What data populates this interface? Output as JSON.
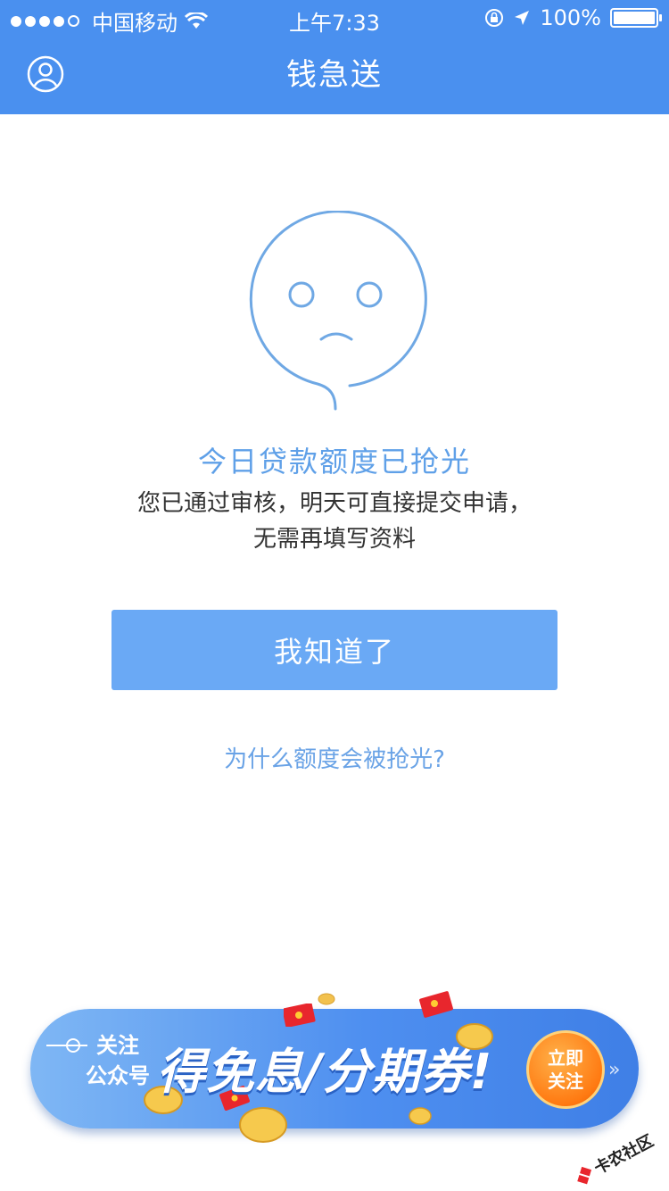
{
  "status_bar": {
    "carrier": "中国移动",
    "time": "上午7:33",
    "battery_percent": "100%",
    "battery_level": 1.0
  },
  "nav": {
    "title": "钱急送"
  },
  "main": {
    "title": "今日贷款额度已抢光",
    "desc_line1": "您已通过审核，明天可直接提交申请，",
    "desc_line2": "无需再填写资料",
    "ok_button": "我知道了",
    "why_link": "为什么额度会被抢光?"
  },
  "banner": {
    "sub_line1": "关注",
    "sub_line2": "公众号",
    "headline": "得免息/分期券!",
    "cta_line1": "立即",
    "cta_line2": "关注"
  },
  "watermark": {
    "text": "卡农社区"
  },
  "colors": {
    "nav_bg": "#4a90ef",
    "accent_text": "#5fa0e8",
    "button_bg": "#6aa9f5"
  }
}
